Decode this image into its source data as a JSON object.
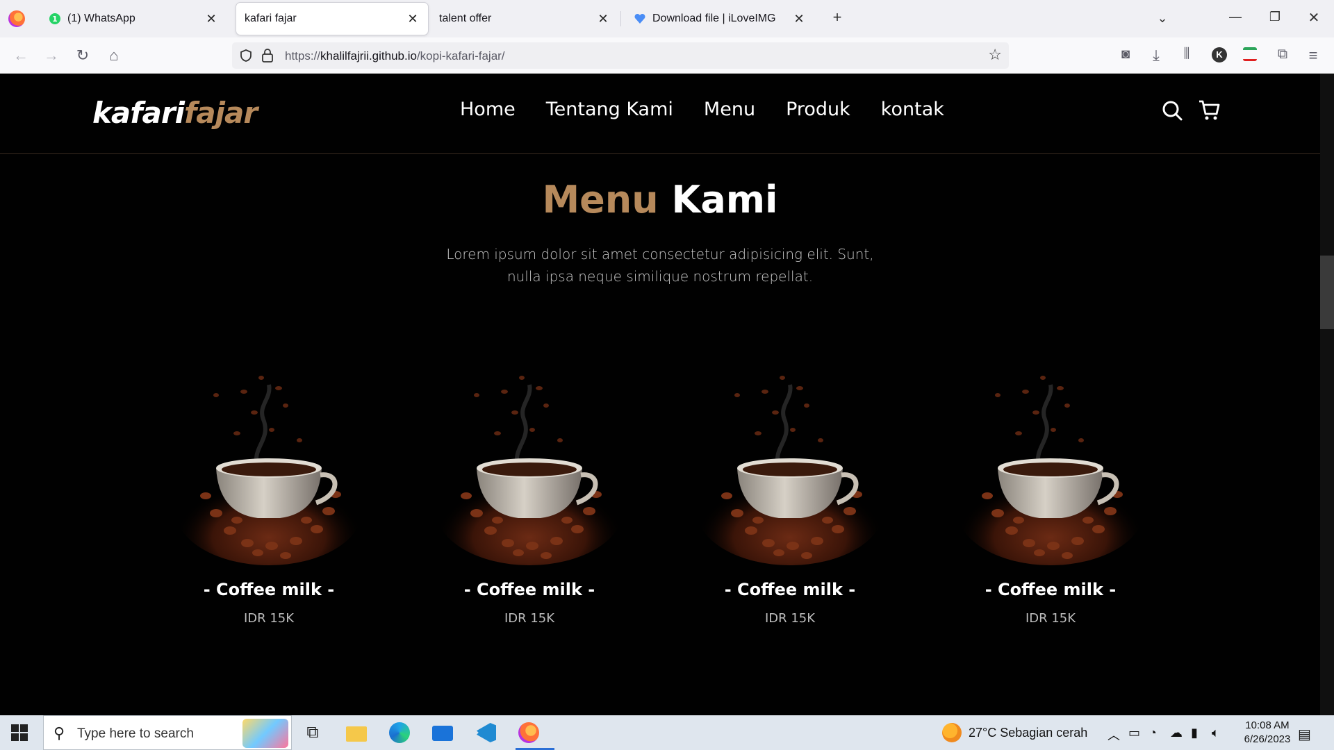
{
  "browser": {
    "tabs": [
      {
        "title": "(1) WhatsApp",
        "icon": "whatsapp-icon",
        "active": false
      },
      {
        "title": "kafari fajar",
        "icon": "",
        "active": true
      },
      {
        "title": "talent offer",
        "icon": "",
        "active": false
      },
      {
        "title": "Download file | iLoveIMG",
        "icon": "iloveimg-icon",
        "active": false
      }
    ],
    "url_prefix": "https://",
    "url_host": "khalilfajrii.github.io",
    "url_path": "/kopi-kafari-fajar/"
  },
  "site": {
    "logo_main": "kafari",
    "logo_accent": "fajar",
    "nav": [
      "Home",
      "Tentang Kami",
      "Menu",
      "Produk",
      "kontak"
    ],
    "section_title_accent": "Menu",
    "section_title_rest": "Kami",
    "section_desc": "Lorem ipsum dolor sit amet consectetur adipisicing elit. Sunt, nulla ipsa neque similique nostrum repellat.",
    "menu_items": [
      {
        "name": "- Coffee milk -",
        "price": "IDR 15K"
      },
      {
        "name": "- Coffee milk -",
        "price": "IDR 15K"
      },
      {
        "name": "- Coffee milk -",
        "price": "IDR 15K"
      },
      {
        "name": "- Coffee milk -",
        "price": "IDR 15K"
      }
    ],
    "accent_color": "#b6895b"
  },
  "taskbar": {
    "search_placeholder": "Type here to search",
    "weather": "27°C  Sebagian cerah",
    "time": "10:08 AM",
    "date": "6/26/2023"
  }
}
